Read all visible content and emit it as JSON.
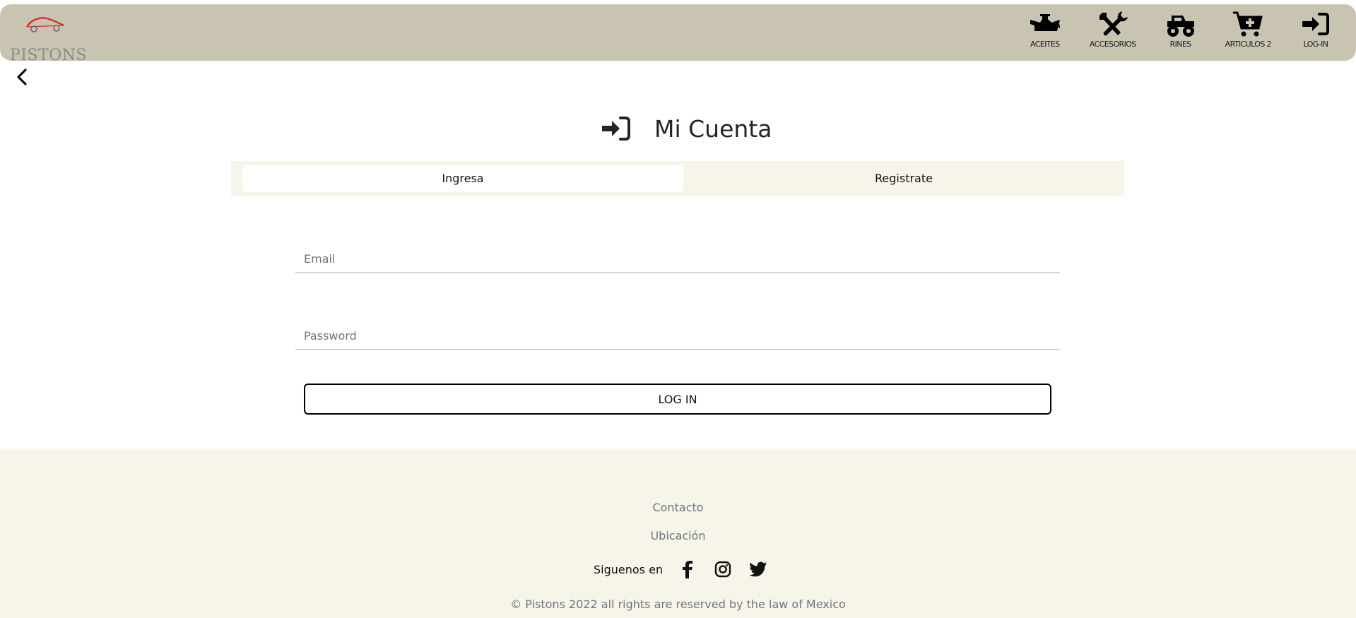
{
  "header": {
    "brand_name": "PISTONS",
    "nav": [
      {
        "label": "ACEITES",
        "icon": "oil-can-icon"
      },
      {
        "label": "ACCESORIOS",
        "icon": "tools-icon"
      },
      {
        "label": "RINES",
        "icon": "monster-truck-icon"
      },
      {
        "label": "ARTICULOS 2",
        "icon": "cart-plus-icon"
      },
      {
        "label": "LOG-IN",
        "icon": "sign-in-icon"
      }
    ]
  },
  "main": {
    "title": "Mi Cuenta",
    "tabs": [
      {
        "label": "Ingresa",
        "active": true
      },
      {
        "label": "Registrate",
        "active": false
      }
    ],
    "email_placeholder": "Email",
    "password_placeholder": "Password",
    "login_label": "LOG IN"
  },
  "footer": {
    "contact": "Contacto",
    "location": "Ubicación",
    "follow_label": "Siguenos en",
    "social": [
      "facebook-icon",
      "instagram-icon",
      "twitter-icon"
    ],
    "copyright": "© Pistons 2022 all rights are reserved by the law of Mexico"
  },
  "colors": {
    "header_bg": "#c9c4b1",
    "tabs_bg": "#f7f5ea",
    "footer_bg": "#f7f5ea",
    "logo_red": "#d92b2b"
  }
}
